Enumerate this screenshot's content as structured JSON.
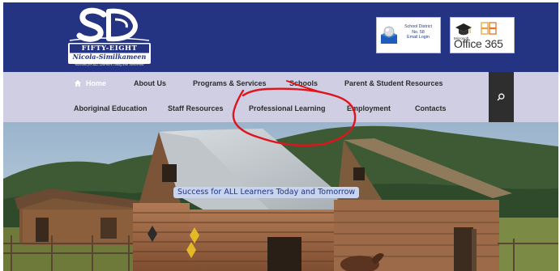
{
  "header": {
    "logo": {
      "monogram": "SD",
      "line1": "FIFTY-EIGHT",
      "line2": "Nicola-Similkameen",
      "motto": "\"Success for ALL Learners Today and Tomorrow\""
    },
    "school_login": {
      "lines": [
        "School District",
        "No. 58",
        "Email Login"
      ]
    },
    "office365": {
      "brand": "Microsoft",
      "label": "Office 365"
    }
  },
  "nav": {
    "row1": [
      {
        "label": "Home",
        "active": true
      },
      {
        "label": "About Us"
      },
      {
        "label": "Programs & Services"
      },
      {
        "label": "Schools"
      },
      {
        "label": "Parent & Student Resources"
      }
    ],
    "row2": [
      {
        "label": "Aboriginal Education"
      },
      {
        "label": "Staff Resources"
      },
      {
        "label": "Professional Learning"
      },
      {
        "label": "Employment"
      },
      {
        "label": "Contacts"
      }
    ],
    "search_icon": "search-icon"
  },
  "hero": {
    "tagline": "Success for ALL Learners Today and Tomorrow"
  },
  "colors": {
    "header_bg": "#243382",
    "nav_bg": "#cfcee3",
    "search_bg": "#2e2e2e",
    "annotation": "#e0141c"
  }
}
